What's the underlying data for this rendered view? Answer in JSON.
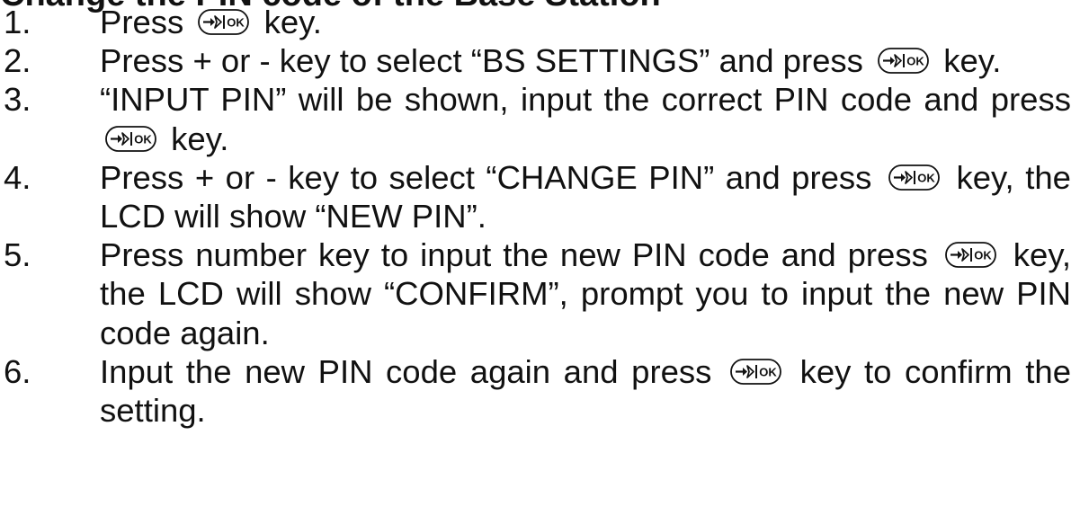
{
  "heading_partial": "Change the PIN code of the Base Station",
  "key_icon": "arrow-ok-key-icon",
  "steps": [
    {
      "num": "1.",
      "a": "Press",
      "b": "key."
    },
    {
      "num": "2.",
      "a": "Press + or - key to select “BS SETTINGS” and press",
      "b": "key."
    },
    {
      "num": "3.",
      "a": "“INPUT PIN” will be shown, input the correct PIN code and press",
      "b": "key."
    },
    {
      "num": "4.",
      "a": "Press + or - key to select “CHANGE PIN” and press",
      "b": "key, the LCD will show “NEW PIN”."
    },
    {
      "num": "5.",
      "a": "Press number key to input the new PIN code and press",
      "b": "key, the LCD will show “CONFIRM”, prompt you to input the new PIN code again."
    },
    {
      "num": "6.",
      "a": "Input the new PIN code again and press",
      "b": "key to confirm the setting."
    }
  ]
}
